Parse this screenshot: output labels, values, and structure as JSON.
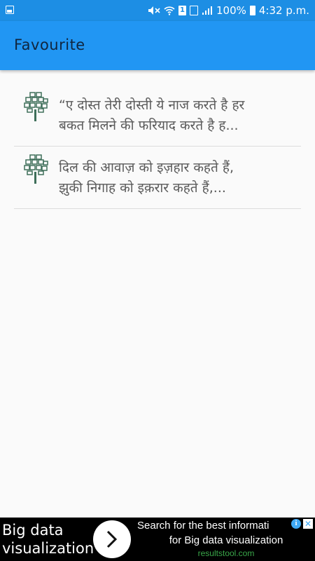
{
  "status_bar": {
    "battery_text": "100%",
    "time": "4:32 p.m.",
    "sim_label": "1",
    "icons": [
      "gallery-icon",
      "mute-icon",
      "wifi-icon",
      "sim-icon",
      "nosim-icon",
      "signal-icon",
      "battery-icon"
    ]
  },
  "app_bar": {
    "title": "Favourite",
    "color": "#2196f3"
  },
  "favourites": [
    {
      "icon": "tree-icon",
      "line1": "“ए दोस्त तेरी दोस्ती ये नाज करते है हर",
      "line2": "बकत मिलने की फरियाद करते है ह..."
    },
    {
      "icon": "tree-icon",
      "line1": "दिल की आवाज़ को इज़हार कहते हैं,",
      "line2": "झुकी निगाह को इक़रार कहते हैं,..."
    }
  ],
  "ad": {
    "left_line1": "Big data",
    "left_line2": "visualization",
    "headline": "Search for the best informati",
    "subline": "for Big data visualization",
    "domain": "resultstool.com",
    "info_glyph": "i",
    "close_glyph": "✕"
  }
}
